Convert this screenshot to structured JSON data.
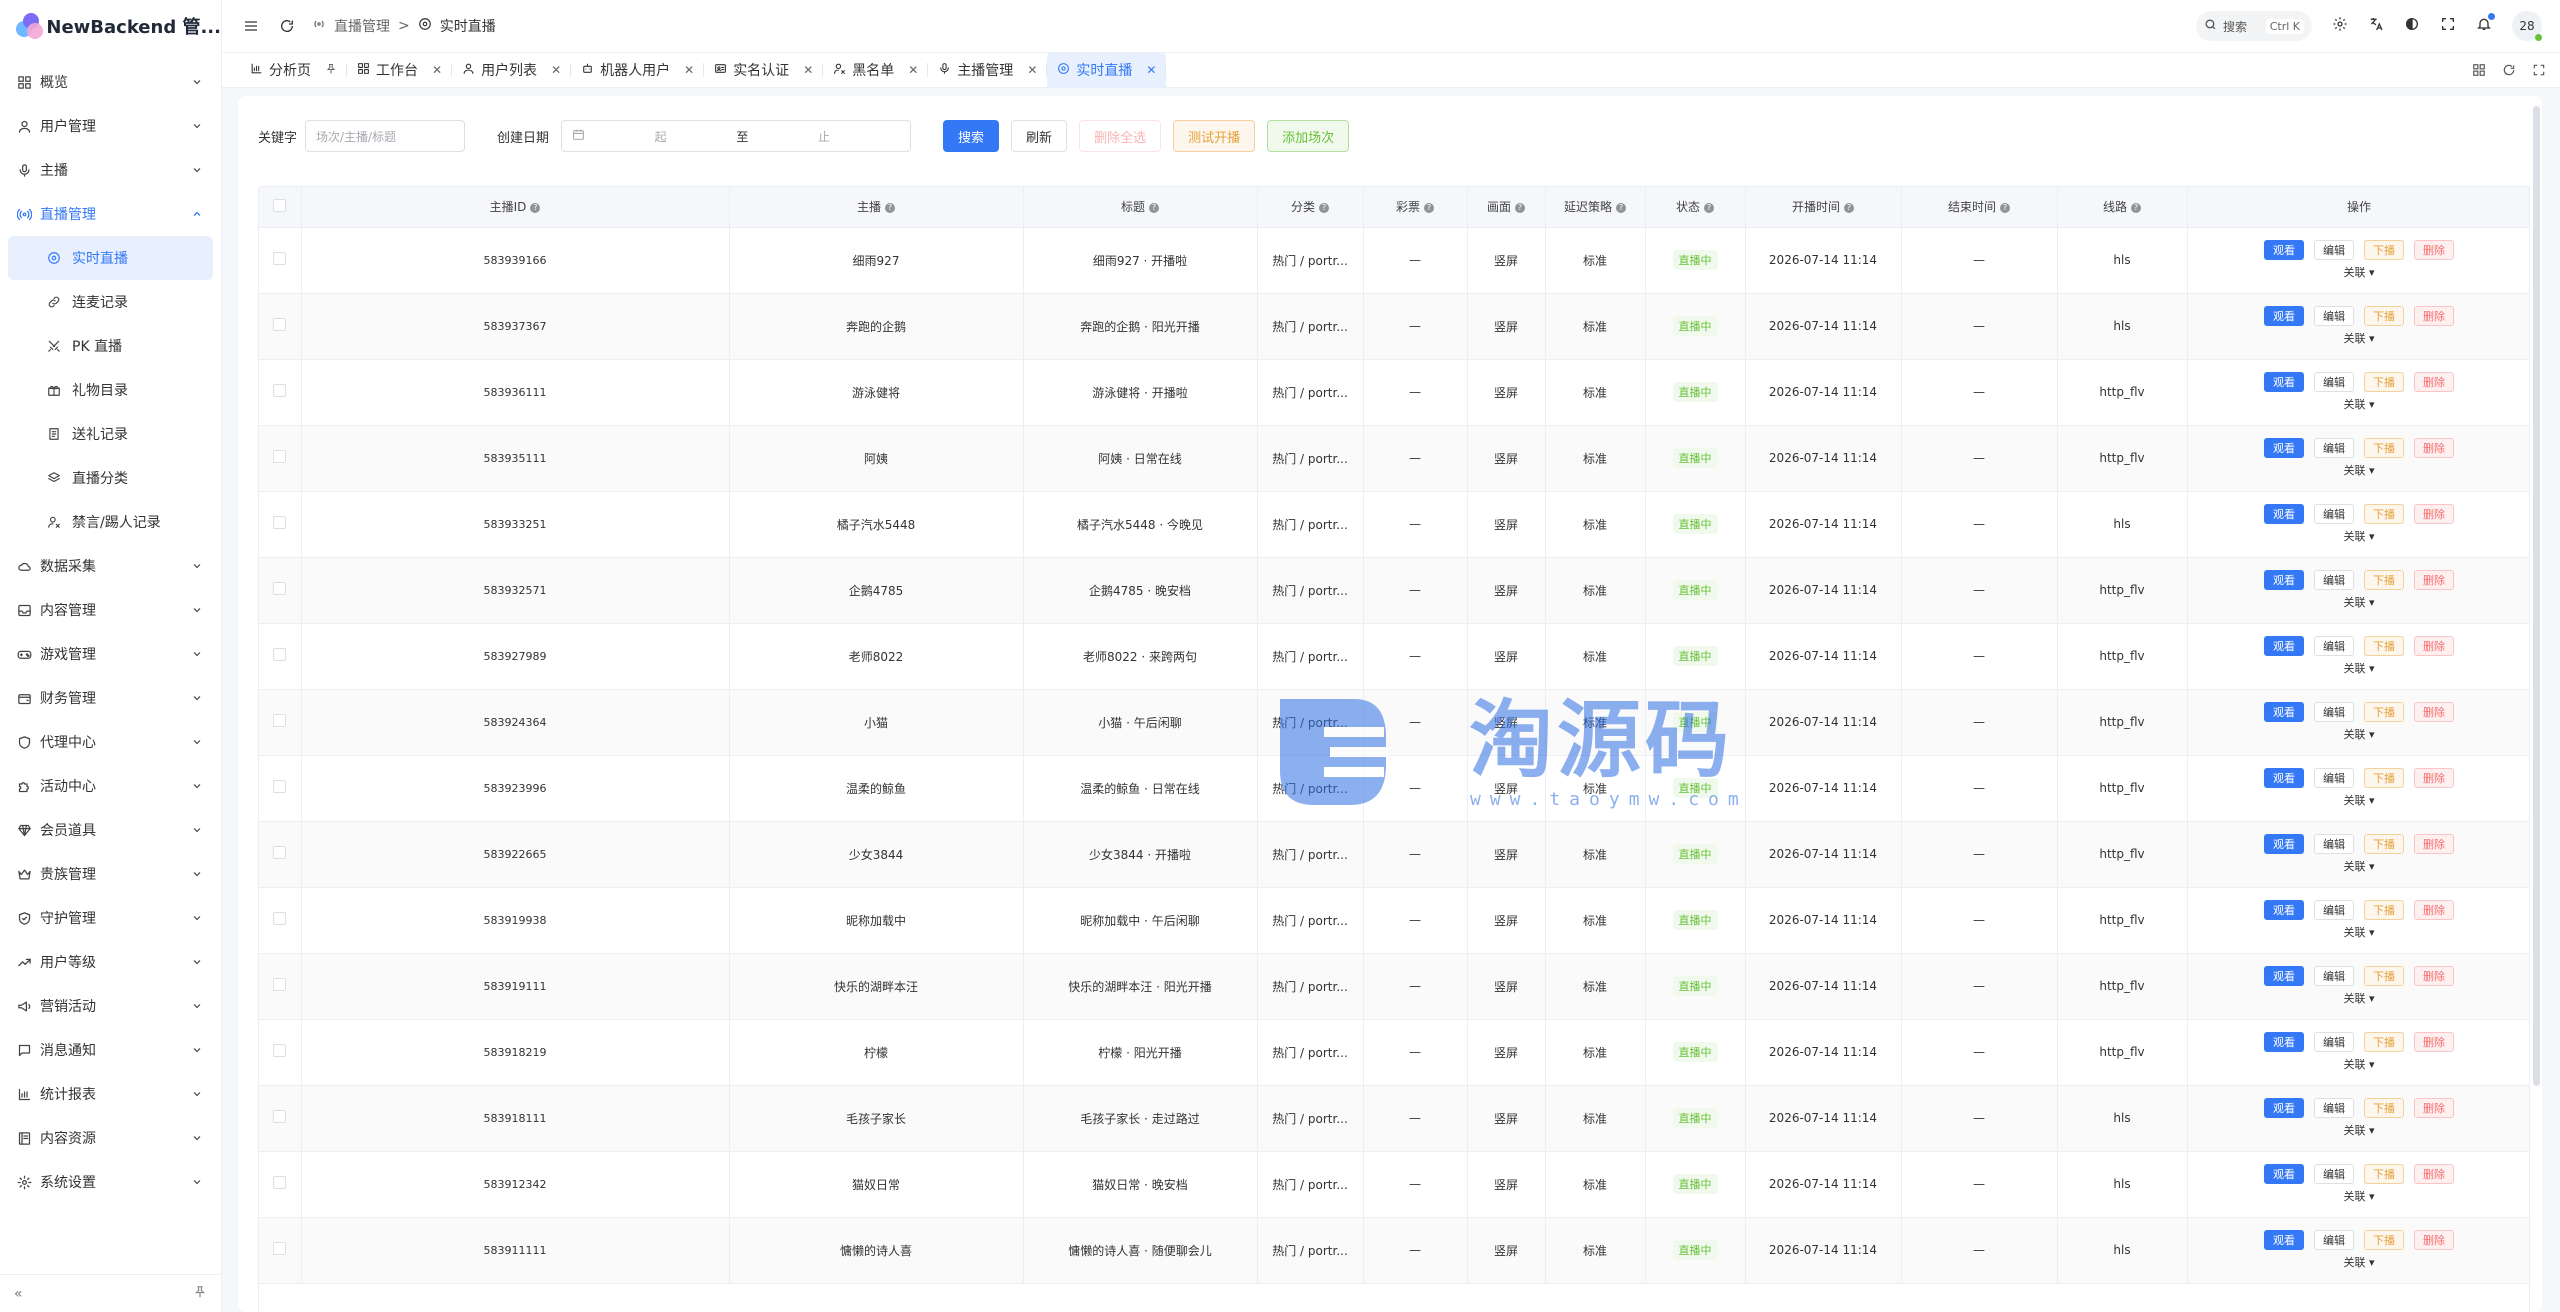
{
  "app": {
    "title": "NewBackend 管..."
  },
  "sidebar": {
    "items": [
      {
        "label": "概览",
        "icon": "grid-icon"
      },
      {
        "label": "用户管理",
        "icon": "user-icon"
      },
      {
        "label": "主播",
        "icon": "mic-icon"
      },
      {
        "label": "直播管理",
        "icon": "broadcast-icon",
        "open": true
      }
    ],
    "sub_items": [
      {
        "label": "实时直播",
        "icon": "live-circle-icon",
        "active": true
      },
      {
        "label": "连麦记录",
        "icon": "link-icon"
      },
      {
        "label": "PK 直播",
        "icon": "swords-icon"
      },
      {
        "label": "礼物目录",
        "icon": "gift-icon"
      },
      {
        "label": "送礼记录",
        "icon": "receipt-icon"
      },
      {
        "label": "直播分类",
        "icon": "layers-icon"
      },
      {
        "label": "禁言/踢人记录",
        "icon": "user-ban-icon"
      }
    ],
    "items_after": [
      {
        "label": "数据采集",
        "icon": "cloud-icon"
      },
      {
        "label": "内容管理",
        "icon": "inbox-icon"
      },
      {
        "label": "游戏管理",
        "icon": "gamepad-icon"
      },
      {
        "label": "财务管理",
        "icon": "wallet-icon"
      },
      {
        "label": "代理中心",
        "icon": "shield-icon"
      },
      {
        "label": "活动中心",
        "icon": "puzzle-icon"
      },
      {
        "label": "会员道具",
        "icon": "gem-icon"
      },
      {
        "label": "贵族管理",
        "icon": "crown-icon"
      },
      {
        "label": "守护管理",
        "icon": "shield-check-icon"
      },
      {
        "label": "用户等级",
        "icon": "trend-icon"
      },
      {
        "label": "营销活动",
        "icon": "megaphone-icon"
      },
      {
        "label": "消息通知",
        "icon": "message-icon"
      },
      {
        "label": "统计报表",
        "icon": "chart-icon"
      },
      {
        "label": "内容资源",
        "icon": "book-icon"
      },
      {
        "label": "系统设置",
        "icon": "gear-icon"
      }
    ],
    "collapse_label": "«"
  },
  "header": {
    "breadcrumb": [
      "直播管理",
      "实时直播"
    ],
    "search_label": "搜索",
    "search_kbd": "Ctrl K",
    "avatar_text": "28"
  },
  "tabs": [
    {
      "label": "分析页",
      "icon": "chart-icon",
      "closable": false,
      "pin": true
    },
    {
      "label": "工作台",
      "icon": "grid-icon",
      "closable": true
    },
    {
      "label": "用户列表",
      "icon": "user-icon",
      "closable": true
    },
    {
      "label": "机器人用户",
      "icon": "robot-icon",
      "closable": true
    },
    {
      "label": "实名认证",
      "icon": "id-icon",
      "closable": true
    },
    {
      "label": "黑名单",
      "icon": "user-ban-icon",
      "closable": true
    },
    {
      "label": "主播管理",
      "icon": "mic-icon",
      "closable": true
    },
    {
      "label": "实时直播",
      "icon": "live-circle-icon",
      "closable": true,
      "active": true
    }
  ],
  "filters": {
    "keyword_label": "关键字",
    "keyword_placeholder": "场次/主播/标题",
    "date_label": "创建日期",
    "date_start": "起",
    "date_sep": "至",
    "date_end": "止",
    "buttons": {
      "search": "搜索",
      "refresh": "刷新",
      "delete_all": "删除全选",
      "test_live": "测试开播",
      "add_session": "添加场次"
    }
  },
  "table": {
    "columns": [
      "主播ID",
      "主播",
      "标题",
      "分类",
      "彩票",
      "画面",
      "延迟策略",
      "状态",
      "开播时间",
      "结束时间",
      "线路",
      "操作"
    ],
    "ops": {
      "view": "观看",
      "edit": "编辑",
      "offline": "下播",
      "delete": "删除",
      "relate": "关联"
    },
    "rows": [
      {
        "id": "583939166",
        "anchor": "细雨927",
        "title": "细雨927 · 开播啦",
        "category": "热门 / portr...",
        "lottery": "—",
        "screen": "竖屏",
        "delay": "标准",
        "status": "直播中",
        "start": "2026-07-14 11:14",
        "end": "—",
        "line": "hls"
      },
      {
        "id": "583937367",
        "anchor": "奔跑的企鹅",
        "title": "奔跑的企鹅 · 阳光开播",
        "category": "热门 / portr...",
        "lottery": "—",
        "screen": "竖屏",
        "delay": "标准",
        "status": "直播中",
        "start": "2026-07-14 11:14",
        "end": "—",
        "line": "hls"
      },
      {
        "id": "583936111",
        "anchor": "游泳健将",
        "title": "游泳健将 · 开播啦",
        "category": "热门 / portr...",
        "lottery": "—",
        "screen": "竖屏",
        "delay": "标准",
        "status": "直播中",
        "start": "2026-07-14 11:14",
        "end": "—",
        "line": "http_flv"
      },
      {
        "id": "583935111",
        "anchor": "阿姨",
        "title": "阿姨 · 日常在线",
        "category": "热门 / portr...",
        "lottery": "—",
        "screen": "竖屏",
        "delay": "标准",
        "status": "直播中",
        "start": "2026-07-14 11:14",
        "end": "—",
        "line": "http_flv"
      },
      {
        "id": "583933251",
        "anchor": "橘子汽水5448",
        "title": "橘子汽水5448 · 今晚见",
        "category": "热门 / portr...",
        "lottery": "—",
        "screen": "竖屏",
        "delay": "标准",
        "status": "直播中",
        "start": "2026-07-14 11:14",
        "end": "—",
        "line": "hls"
      },
      {
        "id": "583932571",
        "anchor": "企鹅4785",
        "title": "企鹅4785 · 晚安档",
        "category": "热门 / portr...",
        "lottery": "—",
        "screen": "竖屏",
        "delay": "标准",
        "status": "直播中",
        "start": "2026-07-14 11:14",
        "end": "—",
        "line": "http_flv"
      },
      {
        "id": "583927989",
        "anchor": "老师8022",
        "title": "老师8022 · 来跨两句",
        "category": "热门 / portr...",
        "lottery": "—",
        "screen": "竖屏",
        "delay": "标准",
        "status": "直播中",
        "start": "2026-07-14 11:14",
        "end": "—",
        "line": "http_flv"
      },
      {
        "id": "583924364",
        "anchor": "小猫",
        "title": "小猫 · 午后闲聊",
        "category": "热门 / portr...",
        "lottery": "—",
        "screen": "竖屏",
        "delay": "标准",
        "status": "直播中",
        "start": "2026-07-14 11:14",
        "end": "—",
        "line": "http_flv"
      },
      {
        "id": "583923996",
        "anchor": "温柔的鲸鱼",
        "title": "温柔的鲸鱼 · 日常在线",
        "category": "热门 / portr...",
        "lottery": "—",
        "screen": "竖屏",
        "delay": "标准",
        "status": "直播中",
        "start": "2026-07-14 11:14",
        "end": "—",
        "line": "http_flv"
      },
      {
        "id": "583922665",
        "anchor": "少女3844",
        "title": "少女3844 · 开播啦",
        "category": "热门 / portr...",
        "lottery": "—",
        "screen": "竖屏",
        "delay": "标准",
        "status": "直播中",
        "start": "2026-07-14 11:14",
        "end": "—",
        "line": "http_flv"
      },
      {
        "id": "583919938",
        "anchor": "昵称加载中",
        "title": "昵称加载中 · 午后闲聊",
        "category": "热门 / portr...",
        "lottery": "—",
        "screen": "竖屏",
        "delay": "标准",
        "status": "直播中",
        "start": "2026-07-14 11:14",
        "end": "—",
        "line": "http_flv"
      },
      {
        "id": "583919111",
        "anchor": "快乐的湖畔本汪",
        "title": "快乐的湖畔本汪 · 阳光开播",
        "category": "热门 / portr...",
        "lottery": "—",
        "screen": "竖屏",
        "delay": "标准",
        "status": "直播中",
        "start": "2026-07-14 11:14",
        "end": "—",
        "line": "http_flv"
      },
      {
        "id": "583918219",
        "anchor": "柠檬",
        "title": "柠檬 · 阳光开播",
        "category": "热门 / portr...",
        "lottery": "—",
        "screen": "竖屏",
        "delay": "标准",
        "status": "直播中",
        "start": "2026-07-14 11:14",
        "end": "—",
        "line": "http_flv"
      },
      {
        "id": "583918111",
        "anchor": "毛孩子家长",
        "title": "毛孩子家长 · 走过路过",
        "category": "热门 / portr...",
        "lottery": "—",
        "screen": "竖屏",
        "delay": "标准",
        "status": "直播中",
        "start": "2026-07-14 11:14",
        "end": "—",
        "line": "hls"
      },
      {
        "id": "583912342",
        "anchor": "猫奴日常",
        "title": "猫奴日常 · 晚安档",
        "category": "热门 / portr...",
        "lottery": "—",
        "screen": "竖屏",
        "delay": "标准",
        "status": "直播中",
        "start": "2026-07-14 11:14",
        "end": "—",
        "line": "hls"
      },
      {
        "id": "583911111",
        "anchor": "慵懒的诗人喜",
        "title": "慵懒的诗人喜 · 随便聊会儿",
        "category": "热门 / portr...",
        "lottery": "—",
        "screen": "竖屏",
        "delay": "标准",
        "status": "直播中",
        "start": "2026-07-14 11:14",
        "end": "—",
        "line": "hls"
      }
    ]
  },
  "watermark": {
    "text": "淘源码",
    "url": "www.taoymw.com"
  },
  "colors": {
    "primary": "#3478f6",
    "success": "#67c23a",
    "warning": "#e6a23c",
    "danger": "#f56c6c"
  }
}
